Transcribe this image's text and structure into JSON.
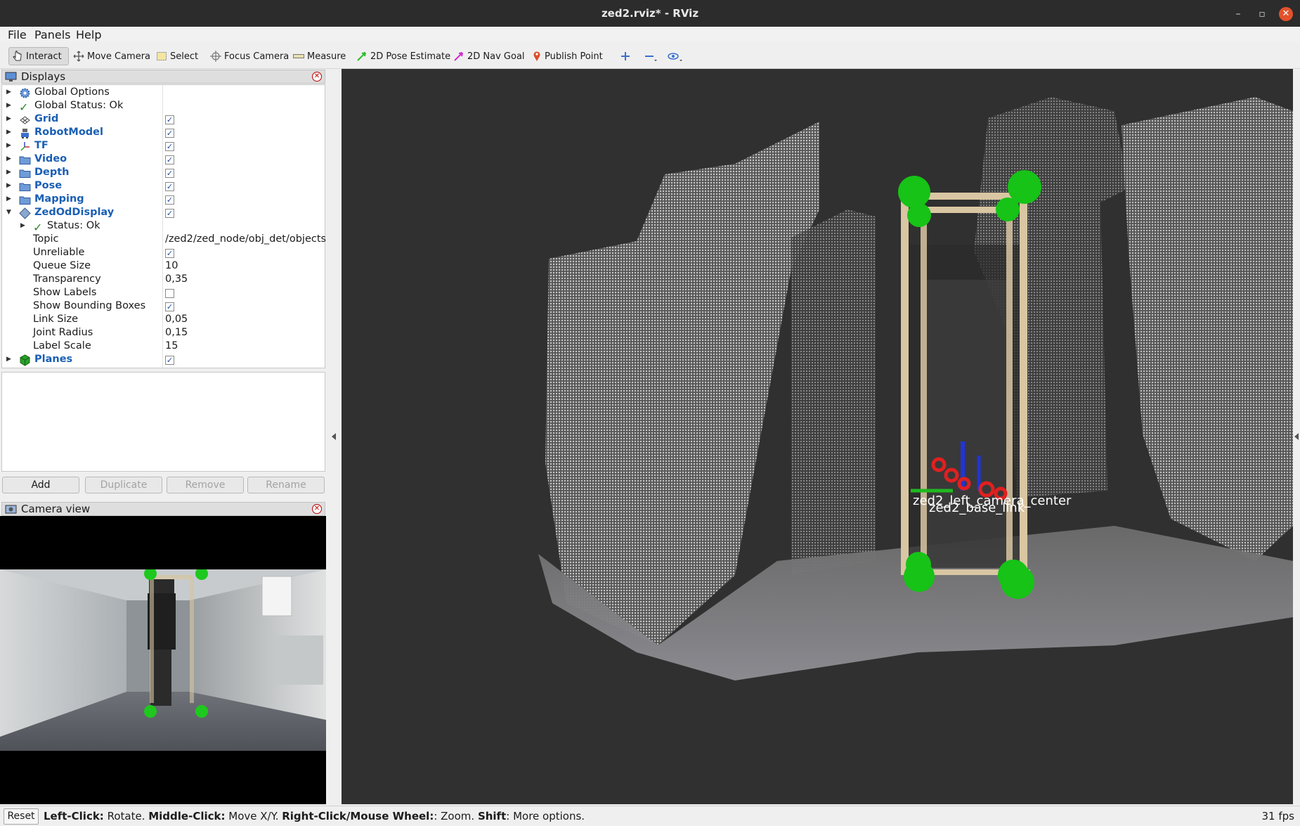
{
  "window": {
    "title": "zed2.rviz* - RViz",
    "minimize": "–",
    "restore": "▫",
    "close": "✕"
  },
  "menu": {
    "file": "File",
    "panels": "Panels",
    "help": "Help"
  },
  "toolbar": {
    "interact": "Interact",
    "move_camera": "Move Camera",
    "select": "Select",
    "focus_camera": "Focus Camera",
    "measure": "Measure",
    "pose_estimate": "2D Pose Estimate",
    "nav_goal": "2D Nav Goal",
    "publish_point": "Publish Point"
  },
  "displays": {
    "title": "Displays",
    "items": [
      {
        "label": "Global Options",
        "icon": "gear-icon"
      },
      {
        "label": "Global Status: Ok",
        "icon": "check-icon"
      },
      {
        "label": "Grid",
        "icon": "grid-icon",
        "checked": true
      },
      {
        "label": "RobotModel",
        "icon": "robot-icon",
        "checked": true
      },
      {
        "label": "TF",
        "icon": "axes-icon",
        "checked": true
      },
      {
        "label": "Video",
        "icon": "folder-icon",
        "checked": true
      },
      {
        "label": "Depth",
        "icon": "folder-icon",
        "checked": true
      },
      {
        "label": "Pose",
        "icon": "folder-icon",
        "checked": true
      },
      {
        "label": "Mapping",
        "icon": "folder-icon",
        "checked": true
      },
      {
        "label": "ZedOdDisplay",
        "icon": "diamond-icon",
        "checked": true
      }
    ],
    "zed_props": {
      "status": "Status: Ok",
      "topic_label": "Topic",
      "topic_value": "/zed2/zed_node/obj_det/objects",
      "unreliable_label": "Unreliable",
      "queue_label": "Queue Size",
      "queue_value": "10",
      "transparency_label": "Transparency",
      "transparency_value": "0,35",
      "show_labels_label": "Show Labels",
      "show_bbox_label": "Show Bounding Boxes",
      "link_size_label": "Link Size",
      "link_size_value": "0,05",
      "joint_radius_label": "Joint Radius",
      "joint_radius_value": "0,15",
      "label_scale_label": "Label Scale",
      "label_scale_value": "15"
    },
    "planes": "Planes"
  },
  "buttons": {
    "add": "Add",
    "duplicate": "Duplicate",
    "remove": "Remove",
    "rename": "Rename"
  },
  "camera_view": {
    "title": "Camera view"
  },
  "viewport": {
    "frame_label_1": "zed2_left_camera_center",
    "frame_label_2": "zed2_base_link"
  },
  "status": {
    "reset": "Reset",
    "k1": "Left-Click:",
    "t1": " Rotate. ",
    "k2": "Middle-Click:",
    "t2": " Move X/Y. ",
    "k3": "Right-Click/Mouse Wheel:",
    "t3": ": Zoom. ",
    "k4": "Shift",
    "t4": ": More options.",
    "fps": "31 fps"
  }
}
